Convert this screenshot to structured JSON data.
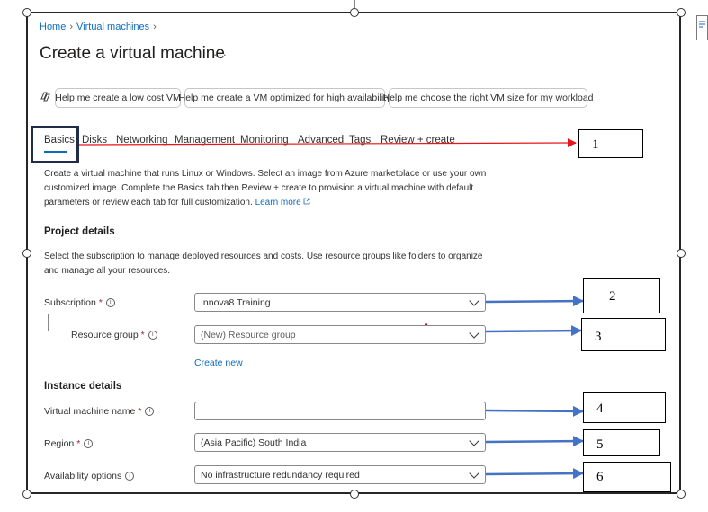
{
  "breadcrumb": [
    "Home",
    "Virtual machines"
  ],
  "page_title": "Create a virtual machine",
  "title_more": "···",
  "copilot_icon": "copilot-icon",
  "assist_buttons": [
    "Help me create a low cost VM",
    "Help me create a VM optimized for high availability",
    "Help me choose the right VM size for my workload"
  ],
  "tabs": [
    "Basics",
    "Disks",
    "Networking",
    "Management",
    "Monitoring",
    "Advanced",
    "Tags",
    "Review + create"
  ],
  "active_tab": "Basics",
  "intro": {
    "text": "Create a virtual machine that runs Linux or Windows. Select an image from Azure marketplace or use your own customized image. Complete the Basics tab then Review + create to provision a virtual machine with default parameters or review each tab for full customization.",
    "link": "Learn more"
  },
  "project": {
    "heading": "Project details",
    "description": "Select the subscription to manage deployed resources and costs. Use resource groups like folders to organize and manage all your resources.",
    "subscription_label": "Subscription",
    "subscription_value": "Innova8 Training",
    "resource_group_label": "Resource group",
    "resource_group_value": "(New) Resource group",
    "create_new": "Create new"
  },
  "instance": {
    "heading": "Instance details",
    "vm_name_label": "Virtual machine name",
    "vm_name_value": "",
    "region_label": "Region",
    "region_value": "(Asia Pacific) South India",
    "availability_label": "Availability options",
    "availability_value": "No infrastructure redundancy required"
  },
  "required_mark": "*",
  "info_glyph": "i",
  "callouts": [
    "1",
    "2",
    "3",
    "4",
    "5",
    "6"
  ],
  "colors": {
    "link": "#0f6cbd",
    "red_arrow": "#e8141b",
    "blue_arrow": "#4472c4",
    "highlight_box": "#1f2d4a"
  }
}
